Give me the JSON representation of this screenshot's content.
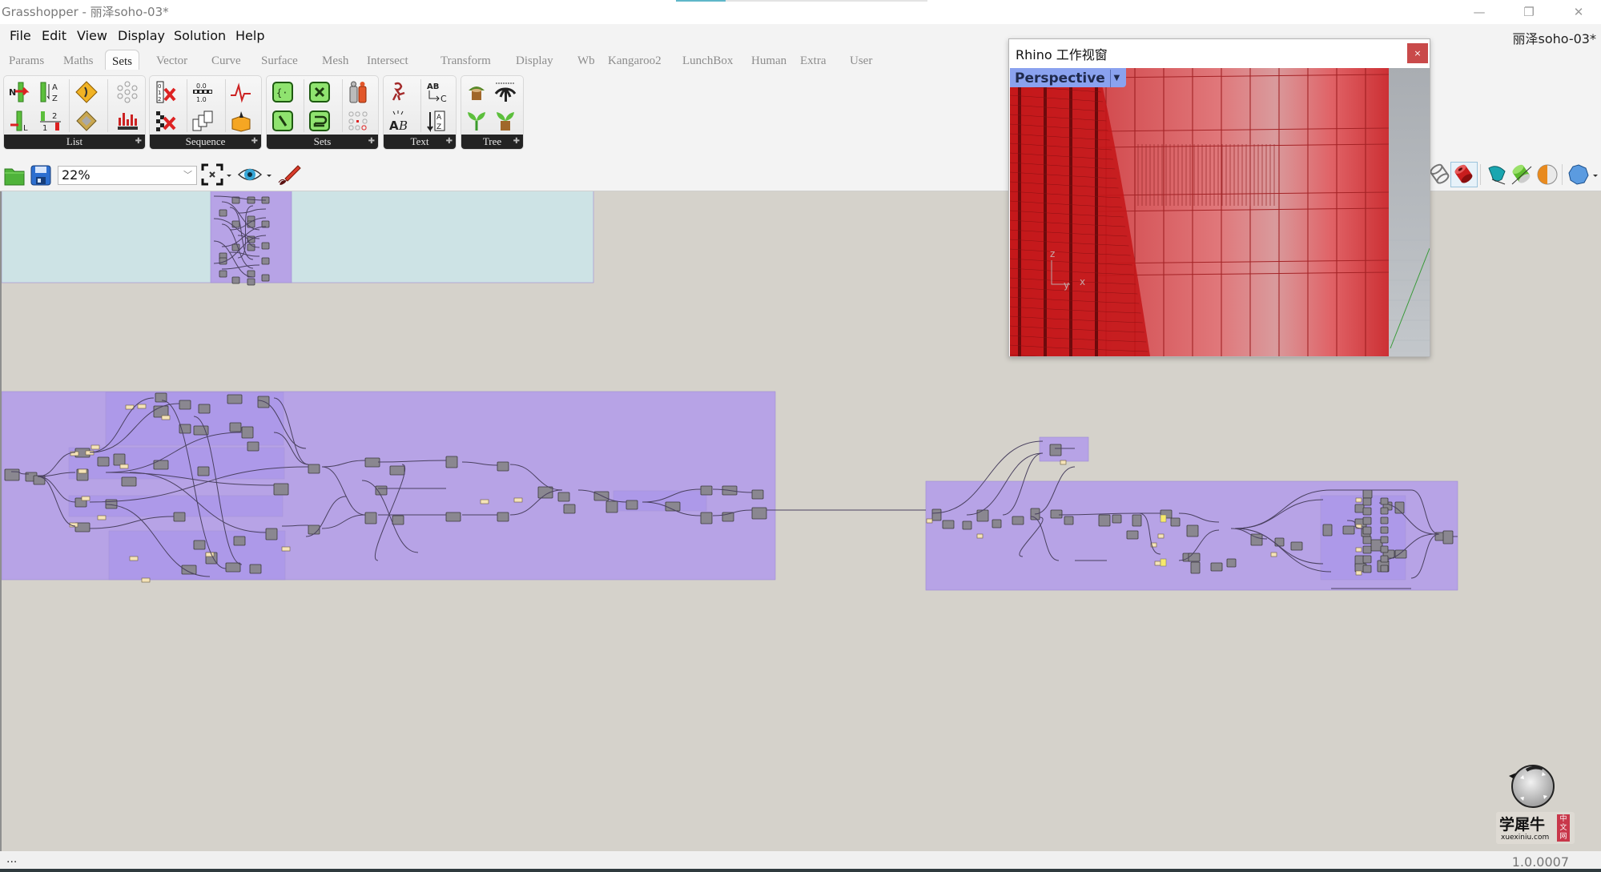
{
  "window": {
    "title": "Grasshopper - 丽泽soho-03*",
    "controls": {
      "minimize": "—",
      "restore": "❐",
      "close": "✕"
    }
  },
  "menu": {
    "items": [
      "File",
      "Edit",
      "View",
      "Display",
      "Solution",
      "Help"
    ],
    "document_name": "丽泽soho-03*"
  },
  "tabs": {
    "items": [
      "Params",
      "Maths",
      "Sets",
      "Vector",
      "Curve",
      "Surface",
      "Mesh",
      "Intersect",
      "Transform",
      "Display",
      "Wb",
      "Kangaroo2",
      "LunchBox",
      "Human",
      "Extra",
      "User"
    ],
    "active": "Sets"
  },
  "ribbon": {
    "groups": [
      {
        "label": "List",
        "icons": [
          "list-item-icon",
          "sort-list-icon",
          "dispatch-icon",
          "partition-icon",
          "list-length-icon",
          "split-list-icon",
          "pick-choose-icon",
          "replace-items-icon"
        ]
      },
      {
        "label": "Sequence",
        "icons": [
          "cull-index-icon",
          "range-icon",
          "random-icon",
          "cull-pattern-icon",
          "series-icon",
          "duplicate-icon"
        ]
      },
      {
        "label": "Sets",
        "icons": [
          "set-union-icon",
          "set-difference-icon",
          "key-value-icon",
          "set-intersection-icon",
          "member-index-icon",
          "delete-consecutive-icon"
        ]
      },
      {
        "label": "Text",
        "icons": [
          "text-join-icon",
          "text-replace-icon",
          "text-case-icon",
          "sort-text-icon"
        ]
      },
      {
        "label": "Tree",
        "icons": [
          "prune-tree-icon",
          "flatten-tree-icon",
          "graft-tree-icon",
          "simplify-tree-icon"
        ]
      }
    ]
  },
  "canvas_toolbar": {
    "zoom_value": "22%",
    "buttons": [
      "open-file",
      "save-file",
      "zoom-extents",
      "preview-mode",
      "sketch"
    ],
    "right_buttons": [
      "wireframe-preview",
      "shaded-preview",
      "selected-preview-a",
      "selected-preview-b",
      "material-preview",
      "mesh-quality"
    ]
  },
  "rhino_viewport": {
    "title": "Rhino 工作视窗",
    "close": "×",
    "view_name": "Perspective",
    "axis_labels": {
      "z": "z",
      "y": "y",
      "x": "x"
    }
  },
  "status": {
    "left_text": "...",
    "version": "1.0.0007"
  },
  "watermark": {
    "logo_text": "学犀牛",
    "badge": "中文网",
    "url": "xuexiniu.com"
  },
  "colors": {
    "canvas": "#d5d2cb",
    "group_purple": "#b7a3e6",
    "group_cyan": "#cde3e5",
    "component": "#8a8790",
    "panel": "#f5e3b8",
    "rhino_red": "#cc2a2e"
  }
}
